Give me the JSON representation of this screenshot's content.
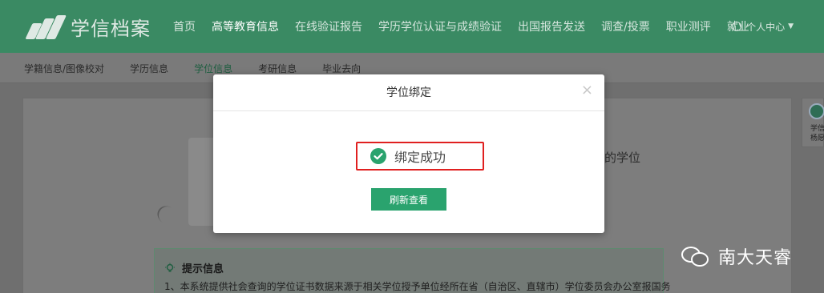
{
  "brand": {
    "name": "学信档案"
  },
  "nav": {
    "items": [
      {
        "label": "首页"
      },
      {
        "label": "高等教育信息"
      },
      {
        "label": "在线验证报告"
      },
      {
        "label": "学历学位认证与成绩验证"
      },
      {
        "label": "出国报告发送"
      },
      {
        "label": "调查/投票"
      },
      {
        "label": "职业测评"
      },
      {
        "label": "就业"
      }
    ],
    "user_label": "个人中心"
  },
  "subnav": {
    "items": [
      {
        "label": "学籍信息/图像校对"
      },
      {
        "label": "学历信息"
      },
      {
        "label": "学位信息"
      },
      {
        "label": "考研信息"
      },
      {
        "label": "毕业去向"
      }
    ]
  },
  "content": {
    "right_text": "的学位",
    "tip_title": "提示信息",
    "tip_line": "1、本系统提供社会查询的学位证书数据来源于相关学位授予单位经所在省（自治区、直辖市）学位委员会办公室报国务"
  },
  "side_widget": {
    "text_line1": "学信",
    "text_line2": "杨愿..."
  },
  "watermark": {
    "text": "南大天睿"
  },
  "modal": {
    "title": "学位绑定",
    "close_symbol": "×",
    "status_text": "绑定成功",
    "button_label": "刷新查看"
  },
  "colors": {
    "brand_green": "#3a8a63",
    "success_green": "#2aa36e",
    "highlight_red": "#e02020"
  }
}
